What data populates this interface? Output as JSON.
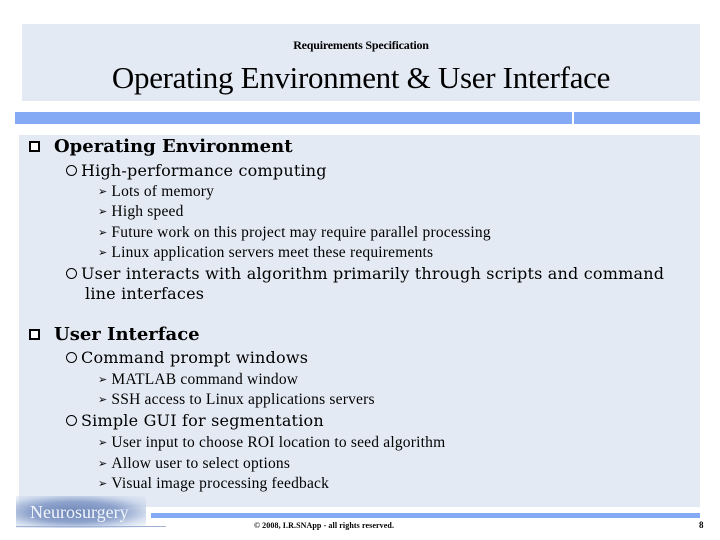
{
  "header": {
    "subtitle": "Requirements Specification",
    "title": "Operating Environment & User Interface"
  },
  "sections": [
    {
      "heading": "Operating Environment",
      "bullet_icon": "square-bullet",
      "items": [
        {
          "text": "High-performance computing",
          "bullet_icon": "circle-bullet",
          "subitems": [
            "Lots of memory",
            "High speed",
            "Future work on this project may require parallel processing",
            "Linux application servers meet these requirements"
          ]
        },
        {
          "text": "User interacts with algorithm primarily through scripts and command",
          "continuation": "line interfaces",
          "bullet_icon": "circle-bullet",
          "subitems": []
        }
      ]
    },
    {
      "heading": "User Interface",
      "bullet_icon": "square-bullet",
      "items": [
        {
          "text": "Command prompt windows",
          "bullet_icon": "circle-bullet",
          "subitems": [
            "MATLAB command window",
            "SSH access to Linux applications servers"
          ]
        },
        {
          "text": "Simple GUI for segmentation",
          "bullet_icon": "circle-bullet",
          "subitems": [
            "User input to choose ROI location to seed algorithm",
            "Allow user to select options",
            "Visual image processing feedback"
          ]
        }
      ]
    }
  ],
  "footer": {
    "logo_text": "Neurosurgery",
    "copyright": "© 2008, I.R.SNApp - all rights reserved.",
    "page_number": "8"
  },
  "colors": {
    "panel_background": "#e4eaf4",
    "accent_bar": "#84a9f5"
  },
  "arrow_glyph": "➢"
}
